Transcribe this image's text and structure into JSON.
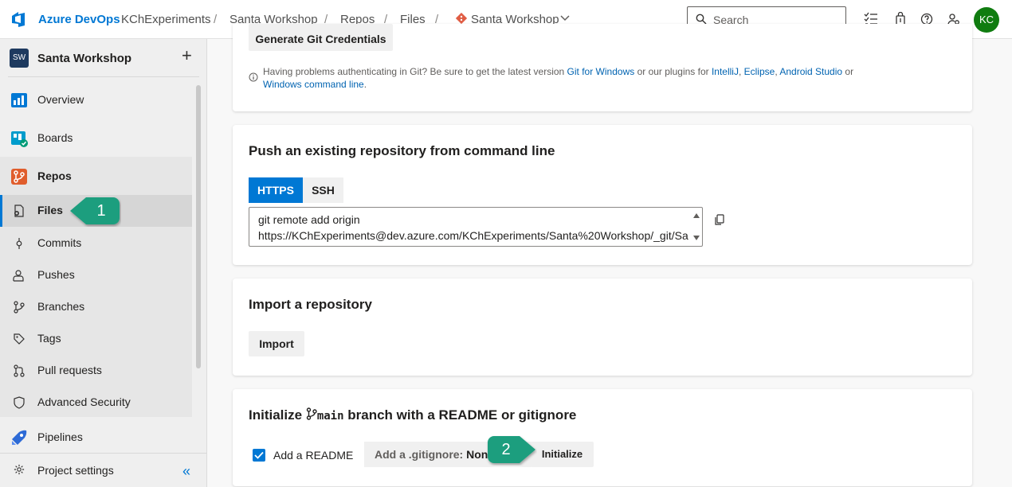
{
  "topbar": {
    "brand": "Azure DevOps",
    "breadcrumbs": [
      "KChExperiments",
      "Santa Workshop",
      "Repos",
      "Files",
      "Santa Workshop"
    ],
    "separator": "/",
    "search_placeholder": "Search",
    "avatar_initials": "KC",
    "avatar_color": "#107c10",
    "accent": "#0078d4"
  },
  "sidebar": {
    "project_badge": "SW",
    "project_name": "Santa Workshop",
    "add": "+",
    "items": [
      {
        "label": "Overview",
        "icon": "overview-icon"
      },
      {
        "label": "Boards",
        "icon": "boards-icon"
      },
      {
        "label": "Repos",
        "icon": "repos-icon"
      },
      {
        "label": "Files",
        "icon": "files-icon",
        "selected": true
      },
      {
        "label": "Commits",
        "icon": "commits-icon"
      },
      {
        "label": "Pushes",
        "icon": "pushes-icon"
      },
      {
        "label": "Branches",
        "icon": "branches-icon"
      },
      {
        "label": "Tags",
        "icon": "tags-icon"
      },
      {
        "label": "Pull requests",
        "icon": "pull-requests-icon"
      },
      {
        "label": "Advanced Security",
        "icon": "shield-icon"
      },
      {
        "label": "Pipelines",
        "icon": "pipelines-icon"
      }
    ],
    "settings_label": "Project settings",
    "collapse_glyph": "«"
  },
  "main": {
    "credentials_button": "Generate Git Credentials",
    "help": {
      "prefix": "Having problems authenticating in Git? Be sure to get the latest version ",
      "link1": "Git for Windows",
      "mid": " or our plugins for ",
      "link2": "IntelliJ",
      "comma1": ", ",
      "link3": "Eclipse",
      "comma2": ", ",
      "link4": "Android Studio",
      "or": " or",
      "link5": "Windows command line",
      "end": "."
    },
    "push": {
      "title": "Push an existing repository from command line",
      "tab_https": "HTTPS",
      "tab_ssh": "SSH",
      "code_line1": "git remote add origin",
      "code_line2": "https://KChExperiments@dev.azure.com/KChExperiments/Santa%20Workshop/_git/Sa"
    },
    "import": {
      "title": "Import a repository",
      "button": "Import"
    },
    "initialize": {
      "title_prefix": "Initialize",
      "branch": "main",
      "title_suffix": "branch with a README or gitignore",
      "readme_label": "Add a README",
      "readme_checked": true,
      "gitignore_label": "Add a .gitignore:",
      "gitignore_value": "None",
      "button": "Initialize"
    }
  },
  "callouts": {
    "one": "1",
    "two": "2",
    "color": "#1e9e7e"
  }
}
